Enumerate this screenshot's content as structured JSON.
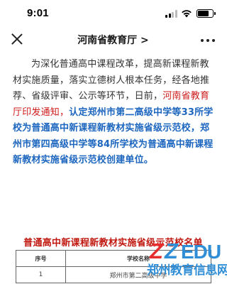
{
  "status": {
    "time": "9:01"
  },
  "navbar": {
    "title": "河南省教育厅 >"
  },
  "article": {
    "intro": "为深化普通高中课程改革，提高新课程新教材实施质量，落实立德树人根本任务，经各地推荐、省级评审、公示等环节，日前，",
    "highlight_red": "河南省教育厅印发通知，",
    "highlight_blue": "认定郑州市第二高级中学等33所学校为普通高中新课程新教材实施省级示范校，郑州市第四高级中学等84所学校为普通高中新课程新教材实施省级示范校创建单位。"
  },
  "table": {
    "title": "普通高中新课程新教材实施省级示范校名单",
    "headers": {
      "num": "序号",
      "name": "学校名称"
    },
    "rows": [
      {
        "num": "1",
        "name": "郑州市第二高级中学"
      }
    ]
  },
  "watermark": {
    "logo_z1": "Z",
    "logo_z2": "Z",
    "logo_edu": "EDU",
    "text": "郑州教育信息网",
    "colors": {
      "z1": "#e62e2e",
      "z2": "#2f8ed6",
      "text": "#2f8ed6"
    }
  },
  "colors": {
    "accent_red": "#cf1b1b",
    "accent_blue": "#1d66bf",
    "table_title": "#c0180f"
  }
}
